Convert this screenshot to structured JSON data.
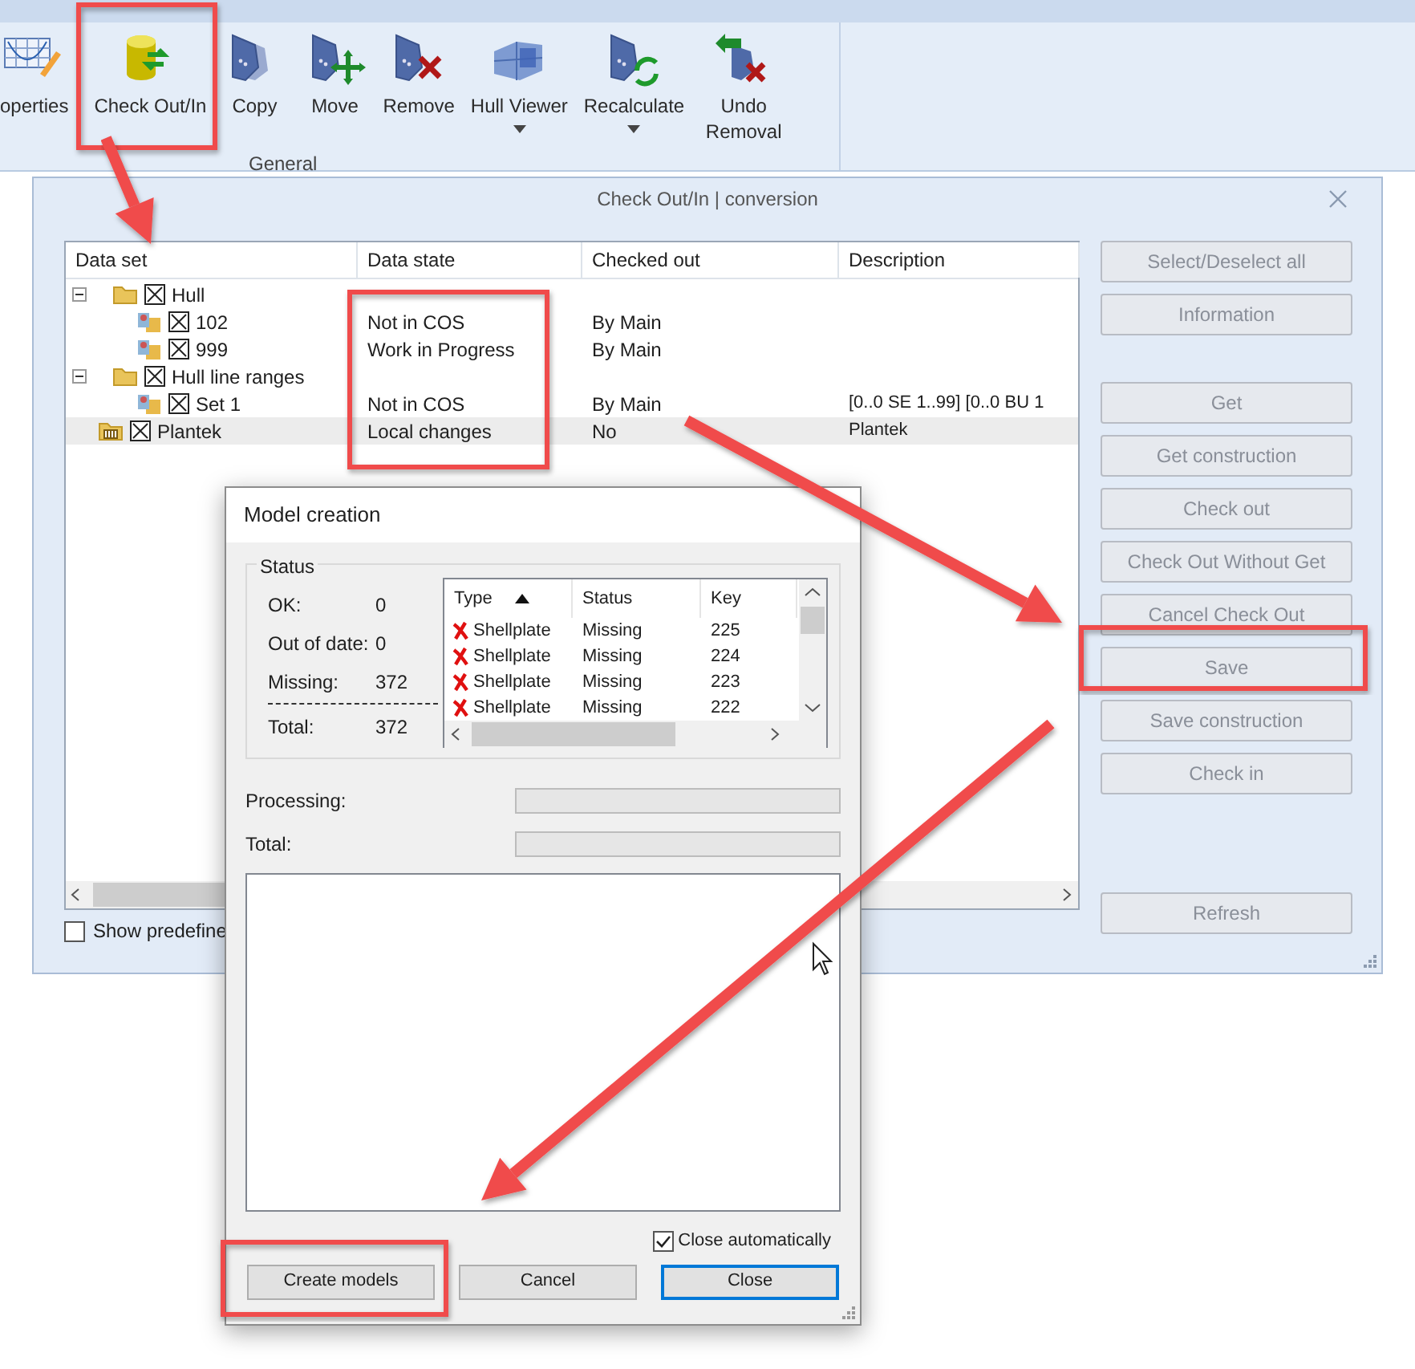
{
  "ribbon": {
    "items": [
      {
        "label": "operties",
        "kind": "properties",
        "dropdown": false
      },
      {
        "label": "Check Out/In",
        "kind": "checkout",
        "dropdown": false
      },
      {
        "label": "Copy",
        "kind": "copy",
        "dropdown": false
      },
      {
        "label": "Move",
        "kind": "move",
        "dropdown": false
      },
      {
        "label": "Remove",
        "kind": "remove",
        "dropdown": false
      },
      {
        "label": "Hull Viewer",
        "kind": "viewer",
        "dropdown": true
      },
      {
        "label": "Recalculate",
        "kind": "recalculate",
        "dropdown": true
      },
      {
        "label": "Undo Removal",
        "kind": "undo",
        "dropdown": false
      }
    ],
    "group_label": "General"
  },
  "checkout_window": {
    "title": "Check Out/In | conversion",
    "columns": [
      "Data set",
      "Data state",
      "Checked out",
      "Description"
    ],
    "rows": [
      {
        "label": "Hull",
        "kind": "folder",
        "checked": true,
        "expanded": true,
        "selected": false,
        "children": [
          {
            "label": "102",
            "kind": "item",
            "checked": true,
            "selected": false,
            "data_state": "Not in COS",
            "checked_out": "By Main"
          },
          {
            "label": "999",
            "kind": "item",
            "checked": true,
            "selected": false,
            "data_state": "Work in Progress",
            "checked_out": "By Main"
          }
        ]
      },
      {
        "label": "Hull line ranges",
        "kind": "folder",
        "checked": true,
        "expanded": true,
        "selected": false,
        "children": [
          {
            "label": "Set 1",
            "kind": "item",
            "checked": true,
            "selected": false,
            "data_state": "Not in COS",
            "checked_out": "By Main",
            "description": "[0..0 SE 1..99] [0..0 BU 1"
          }
        ]
      },
      {
        "label": "Plantek",
        "kind": "plantek",
        "checked": true,
        "selected": true,
        "data_state": "Local changes",
        "checked_out": "No",
        "description": "Plantek"
      }
    ],
    "show_predefined": {
      "label": "Show predefine",
      "checked": false
    },
    "button_groups": [
      [
        {
          "label": "Select/Deselect all",
          "disabled": true
        },
        {
          "label": "Information",
          "disabled": true
        }
      ],
      [
        {
          "label": "Get",
          "disabled": true
        },
        {
          "label": "Get construction",
          "disabled": true
        },
        {
          "label": "Check out",
          "disabled": true
        },
        {
          "label": "Check Out Without Get",
          "disabled": true
        },
        {
          "label": "Cancel Check Out",
          "disabled": true
        },
        {
          "label": "Save",
          "disabled": true
        },
        {
          "label": "Save construction",
          "disabled": true
        },
        {
          "label": "Check in",
          "disabled": true
        }
      ],
      [
        {
          "label": "Refresh",
          "disabled": true
        }
      ]
    ]
  },
  "model_creation": {
    "title": "Model creation",
    "status_label": "Status",
    "stats": [
      {
        "label": "OK:",
        "value": "0"
      },
      {
        "label": "Out of date:",
        "value": "0"
      },
      {
        "label": "Missing:",
        "value": "372"
      }
    ],
    "total": {
      "label": "Total:",
      "value": "372"
    },
    "list_columns": [
      {
        "label": "Type",
        "sorted": true
      },
      {
        "label": "Status",
        "sorted": false
      },
      {
        "label": "Key",
        "sorted": false
      }
    ],
    "list_rows": [
      {
        "type": "Shellplate",
        "status": "Missing",
        "key": "225"
      },
      {
        "type": "Shellplate",
        "status": "Missing",
        "key": "224"
      },
      {
        "type": "Shellplate",
        "status": "Missing",
        "key": "223"
      },
      {
        "type": "Shellplate",
        "status": "Missing",
        "key": "222"
      }
    ],
    "progress": [
      {
        "label": "Processing:",
        "level": 0
      },
      {
        "label": "Total:",
        "level": 0
      }
    ],
    "close_automatically": {
      "label": "Close automatically",
      "checked": true
    },
    "buttons": [
      {
        "label": "Create models",
        "default": false
      },
      {
        "label": "Cancel",
        "default": false
      },
      {
        "label": "Close",
        "default": true
      }
    ]
  }
}
